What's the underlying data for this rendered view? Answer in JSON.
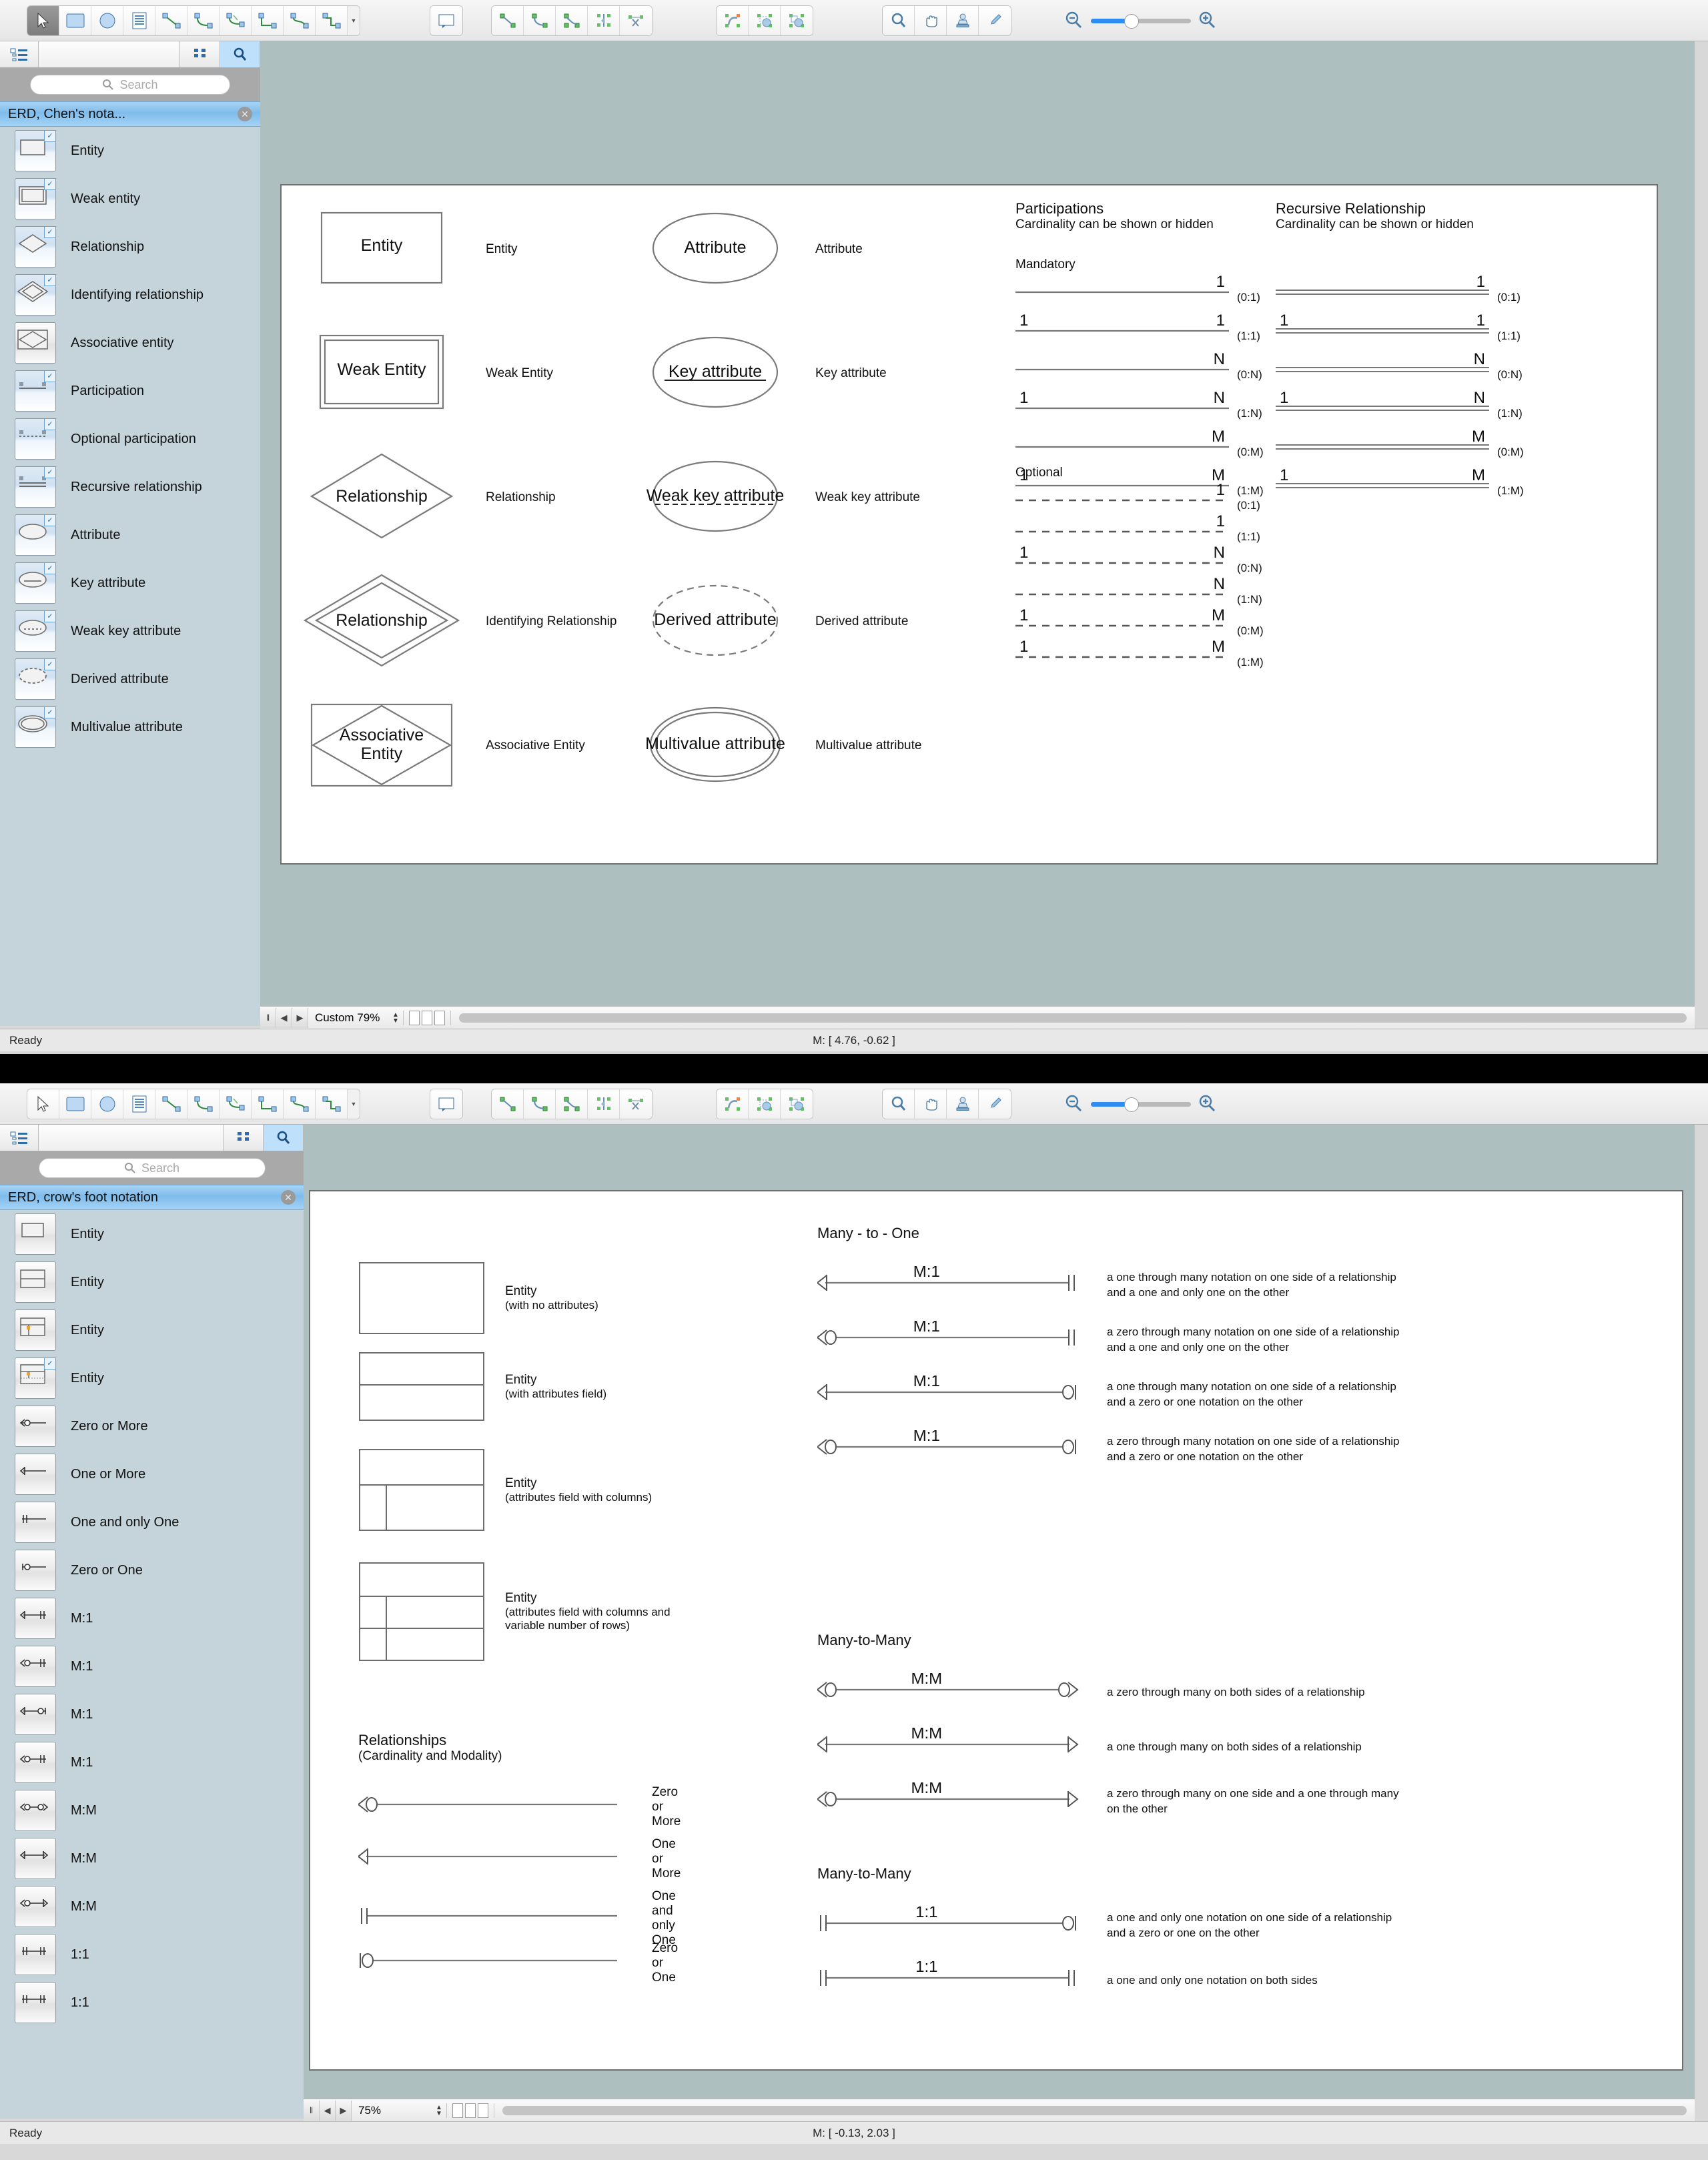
{
  "windows": [
    {
      "id": "chen",
      "toolbar": {
        "tool_groups": [
          {
            "icons": [
              "pointer-icon",
              "rectangle-icon",
              "ellipse-icon",
              "table-icon",
              "line-connector-icon",
              "arc-connector-icon",
              "tree-connector-icon",
              "orthogonal-connector-icon",
              "curve-connector-icon",
              "bezier-connector-icon"
            ],
            "selected": 0,
            "has_caret": true
          },
          {
            "icons": [
              "callout-icon"
            ]
          },
          {
            "icons": [
              "straight-line-icon",
              "arc-line-icon",
              "polyline-icon",
              "mirror-icon",
              "scissors-icon"
            ]
          },
          {
            "icons": [
              "rotate-icon",
              "group-icon",
              "ungroup-icon"
            ]
          },
          {
            "icons": [
              "magnifier-icon",
              "hand-icon",
              "stamp-icon",
              "eyedropper-icon"
            ]
          }
        ],
        "zoom_out_icon": "zoom-out-icon",
        "zoom_in_icon": "zoom-in-icon"
      },
      "sidebar": {
        "header_icons": [
          "tree-view-icon",
          "grid-view-icon",
          "search-view-icon"
        ],
        "search": {
          "placeholder": "Search",
          "value": "",
          "icon": "search-icon"
        },
        "library_title": "ERD, Chen's nota...",
        "close_icon": "close-icon",
        "items": [
          {
            "label": "Entity",
            "shape": "rect",
            "checked": true
          },
          {
            "label": "Weak entity",
            "shape": "double-rect",
            "checked": true
          },
          {
            "label": "Relationship",
            "shape": "diamond",
            "checked": true
          },
          {
            "label": "Identifying relationship",
            "shape": "double-diamond",
            "checked": true
          },
          {
            "label": "Associative entity",
            "shape": "rect-diamond",
            "checked": false
          },
          {
            "label": "Participation",
            "shape": "line",
            "checked": true
          },
          {
            "label": "Optional participation",
            "shape": "dashed-line",
            "checked": true
          },
          {
            "label": "Recursive relationship",
            "shape": "double-line",
            "checked": true
          },
          {
            "label": "Attribute",
            "shape": "ellipse",
            "checked": true
          },
          {
            "label": "Key attribute",
            "shape": "ellipse-underline",
            "checked": true
          },
          {
            "label": "Weak key attribute",
            "shape": "ellipse-dashed-underline",
            "checked": true
          },
          {
            "label": "Derived attribute",
            "shape": "dashed-ellipse",
            "checked": true
          },
          {
            "label": "Multivalue attribute",
            "shape": "double-ellipse",
            "checked": true
          }
        ]
      },
      "diagram": {
        "shape_rows": [
          {
            "shape": "rect",
            "inner_text": "Entity",
            "label": "Entity"
          },
          {
            "shape": "double-rect",
            "inner_text": "Weak Entity",
            "label": "Weak Entity"
          },
          {
            "shape": "diamond",
            "inner_text": "Relationship",
            "label": "Relationship"
          },
          {
            "shape": "double-diamond",
            "inner_text": "Relationship",
            "label": "Identifying Relationship"
          },
          {
            "shape": "rect-diamond",
            "inner_text": "Associative Entity",
            "label": "Associative Entity"
          }
        ],
        "attribute_rows": [
          {
            "shape": "ellipse",
            "inner_text": "Attribute",
            "label": "Attribute"
          },
          {
            "shape": "ellipse-underline",
            "inner_text": "Key attribute",
            "label": "Key attribute"
          },
          {
            "shape": "ellipse-dashed-underline",
            "inner_text": "Weak key attribute",
            "label": "Weak key attribute"
          },
          {
            "shape": "dashed-ellipse",
            "inner_text": "Derived attribute",
            "label": "Derived attribute"
          },
          {
            "shape": "double-ellipse",
            "inner_text": "Multivalue attribute",
            "label": "Multivalue attribute"
          }
        ],
        "participations": {
          "title": "Participations",
          "subtitle": "Cardinality can be shown or hidden",
          "mandatory_label": "Mandatory",
          "optional_label": "Optional",
          "mandatory_rows": [
            {
              "left": "",
              "right": "1",
              "card": "(0:1)"
            },
            {
              "left": "1",
              "right": "1",
              "card": "(1:1)"
            },
            {
              "left": "",
              "right": "N",
              "card": "(0:N)"
            },
            {
              "left": "1",
              "right": "N",
              "card": "(1:N)"
            },
            {
              "left": "",
              "right": "M",
              "card": "(0:M)"
            },
            {
              "left": "1",
              "right": "M",
              "card": "(1:M)"
            }
          ],
          "optional_rows": [
            {
              "left": "",
              "right": "1",
              "card": "(0:1)"
            },
            {
              "left": "",
              "right": "1",
              "card": "(1:1)"
            },
            {
              "left": "1",
              "right": "N",
              "card": "(0:N)"
            },
            {
              "left": "",
              "right": "N",
              "card": "(1:N)"
            },
            {
              "left": "1",
              "right": "M",
              "card": "(0:M)"
            },
            {
              "left": "1",
              "right": "M",
              "card": "(1:M)"
            }
          ]
        },
        "recursive": {
          "title": "Recursive Relationship",
          "subtitle": "Cardinality can be shown or hidden",
          "rows": [
            {
              "left": "",
              "right": "1",
              "card": "(0:1)"
            },
            {
              "left": "1",
              "right": "1",
              "card": "(1:1)"
            },
            {
              "left": "",
              "right": "N",
              "card": "(0:N)"
            },
            {
              "left": "1",
              "right": "N",
              "card": "(1:N)"
            },
            {
              "left": "",
              "right": "M",
              "card": "(0:M)"
            },
            {
              "left": "1",
              "right": "M",
              "card": "(1:M)"
            }
          ]
        }
      },
      "statusbar": {
        "ready": "Ready",
        "coords": "M: [ 4.76, -0.62 ]"
      },
      "scrollbar": {
        "zoom": "Custom 79%",
        "pause_icon": "pause-icon",
        "prev_icon": "prev-icon",
        "next_icon": "next-icon"
      }
    },
    {
      "id": "crowsfoot",
      "toolbar": {
        "tool_groups": [
          {
            "icons": [
              "pointer-icon",
              "rectangle-icon",
              "ellipse-icon",
              "table-icon",
              "line-connector-icon",
              "arc-connector-icon",
              "tree-connector-icon",
              "orthogonal-connector-icon",
              "curve-connector-icon",
              "bezier-connector-icon"
            ],
            "selected": -1,
            "has_caret": true
          },
          {
            "icons": [
              "callout-icon"
            ]
          },
          {
            "icons": [
              "straight-line-icon",
              "arc-line-icon",
              "polyline-icon",
              "mirror-icon",
              "scissors-icon"
            ]
          },
          {
            "icons": [
              "rotate-icon",
              "group-icon",
              "ungroup-icon"
            ]
          },
          {
            "icons": [
              "magnifier-icon",
              "hand-icon",
              "stamp-icon",
              "eyedropper-icon"
            ]
          }
        ],
        "zoom_out_icon": "zoom-out-icon",
        "zoom_in_icon": "zoom-in-icon"
      },
      "sidebar": {
        "header_icons": [
          "tree-view-icon",
          "grid-view-icon",
          "search-view-icon"
        ],
        "search": {
          "placeholder": "Search",
          "value": "",
          "icon": "search-icon"
        },
        "library_title": "ERD, crow's foot notation",
        "close_icon": "close-icon",
        "items": [
          {
            "label": "Entity",
            "shape": "cf-entity1",
            "checked": false
          },
          {
            "label": "Entity",
            "shape": "cf-entity2",
            "checked": false
          },
          {
            "label": "Entity",
            "shape": "cf-entity3",
            "checked": false
          },
          {
            "label": "Entity",
            "shape": "cf-entity4",
            "checked": true
          },
          {
            "label": "Zero or More",
            "shape": "cf-zero-or-more",
            "checked": false
          },
          {
            "label": "One or More",
            "shape": "cf-one-or-more",
            "checked": false
          },
          {
            "label": "One and only One",
            "shape": "cf-one-only-one",
            "checked": false
          },
          {
            "label": "Zero or One",
            "shape": "cf-zero-or-one",
            "checked": false
          },
          {
            "label": "M:1",
            "shape": "cf-m1-a",
            "checked": false
          },
          {
            "label": "M:1",
            "shape": "cf-m1-b",
            "checked": false
          },
          {
            "label": "M:1",
            "shape": "cf-m1-c",
            "checked": false
          },
          {
            "label": "M:1",
            "shape": "cf-m1-d",
            "checked": false
          },
          {
            "label": "M:M",
            "shape": "cf-mm-a",
            "checked": false
          },
          {
            "label": "M:M",
            "shape": "cf-mm-b",
            "checked": false
          },
          {
            "label": "M:M",
            "shape": "cf-mm-c",
            "checked": false
          },
          {
            "label": "1:1",
            "shape": "cf-11-a",
            "checked": false
          },
          {
            "label": "1:1",
            "shape": "cf-11-b",
            "checked": false
          }
        ]
      },
      "diagram": {
        "entities": [
          {
            "label": "Entity",
            "sub": "(with no attributes)",
            "variant": "plain"
          },
          {
            "label": "Entity",
            "sub": "(with attributes field)",
            "variant": "attr"
          },
          {
            "label": "Entity",
            "sub": "(attributes field with columns)",
            "variant": "cols"
          },
          {
            "label": "Entity",
            "sub": "(attributes field with columns and\nvariable number of rows)",
            "variant": "cols-rows"
          }
        ],
        "relationships_legend": {
          "title": "Relationships",
          "subtitle": "(Cardinality and Modality)",
          "rows": [
            {
              "symbol": "zero-or-more",
              "label": "Zero or More"
            },
            {
              "symbol": "one-or-more",
              "label": "One or More"
            },
            {
              "symbol": "one-and-only-one",
              "label": "One and only\nOne"
            },
            {
              "symbol": "zero-or-one",
              "label": "Zero or One"
            }
          ]
        },
        "sections": [
          {
            "title": "Many - to - One",
            "rows": [
              {
                "card": "M:1",
                "left": "one-or-more",
                "right": "one-and-only-one",
                "desc": "a one through many notation on one side of a relationship\nand a one and only one on the other"
              },
              {
                "card": "M:1",
                "left": "zero-or-more",
                "right": "one-and-only-one",
                "desc": "a zero through many notation on one side of a relationship\nand a one and only one on the other"
              },
              {
                "card": "M:1",
                "left": "one-or-more",
                "right": "zero-or-one",
                "desc": "a one through many notation on one side of a relationship\nand a zero or one notation on the other"
              },
              {
                "card": "M:1",
                "left": "zero-or-more",
                "right": "zero-or-one",
                "desc": "a zero through many notation on one side of a relationship\nand a zero or one notation on the other"
              }
            ]
          },
          {
            "title": "Many-to-Many",
            "rows": [
              {
                "card": "M:M",
                "left": "zero-or-more",
                "right": "zero-or-more",
                "desc": "a zero through many on both sides of a relationship"
              },
              {
                "card": "M:M",
                "left": "one-or-more",
                "right": "one-or-more",
                "desc": "a one through many on both sides of a relationship"
              },
              {
                "card": "M:M",
                "left": "zero-or-more",
                "right": "one-or-more",
                "desc": "a zero through many on one side and a one through many\non the other"
              }
            ]
          },
          {
            "title": "Many-to-Many",
            "rows": [
              {
                "card": "1:1",
                "left": "one-and-only-one",
                "right": "zero-or-one",
                "desc": "a one and only one notation on one side of a relationship\nand a zero or one on the other"
              },
              {
                "card": "1:1",
                "left": "one-and-only-one",
                "right": "one-and-only-one",
                "desc": "a one and only one notation on both sides"
              }
            ]
          }
        ]
      },
      "statusbar": {
        "ready": "Ready",
        "coords": "M: [ -0.13, 2.03 ]"
      },
      "scrollbar": {
        "zoom": "75%",
        "pause_icon": "pause-icon",
        "prev_icon": "prev-icon",
        "next_icon": "next-icon"
      }
    }
  ]
}
